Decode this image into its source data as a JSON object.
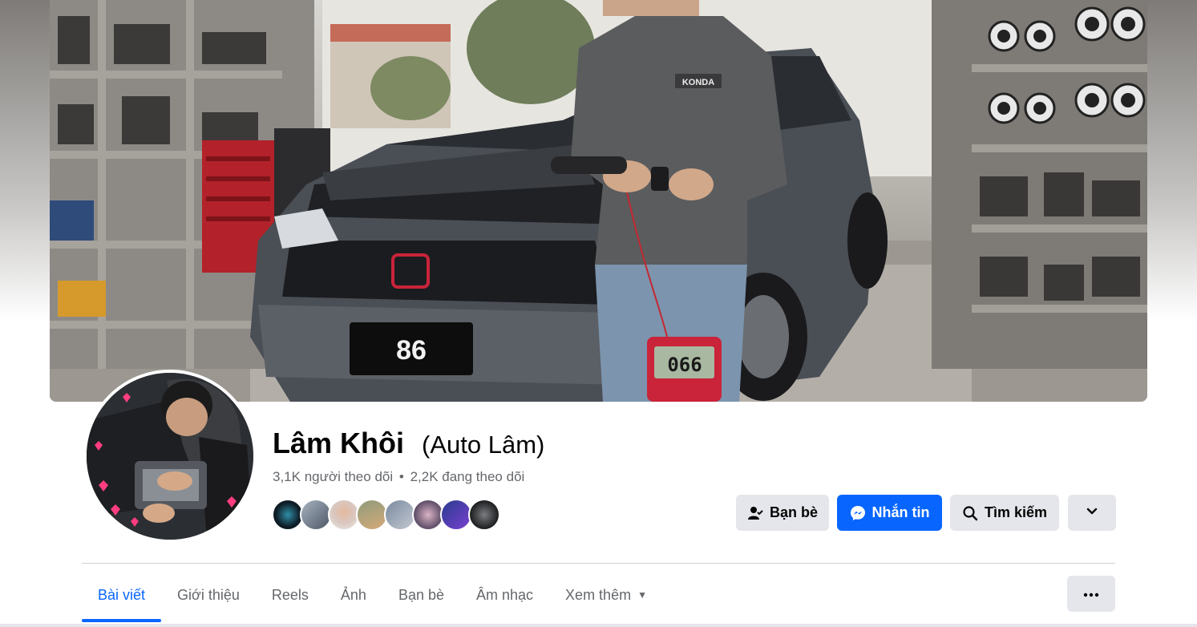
{
  "profile": {
    "name": "Lâm Khôi",
    "alternate_name": "(Auto Lâm)",
    "followers": "3,1K người theo dõi",
    "separator": "•",
    "following": "2,2K đang theo dõi"
  },
  "cover": {
    "plate_text": "86",
    "meter_text": "066",
    "shirt_text": "KONDA"
  },
  "actions": {
    "friends_label": "Bạn bè",
    "message_label": "Nhắn tin",
    "search_label": "Tìm kiếm"
  },
  "tabs": [
    {
      "label": "Bài viết",
      "active": true
    },
    {
      "label": "Giới thiệu"
    },
    {
      "label": "Reels"
    },
    {
      "label": "Ảnh"
    },
    {
      "label": "Bạn bè"
    },
    {
      "label": "Âm nhạc"
    },
    {
      "label": "Xem thêm"
    }
  ],
  "colors": {
    "accent": "#0866ff",
    "button_gray": "#e4e6eb",
    "secondary_text": "#65676b"
  }
}
